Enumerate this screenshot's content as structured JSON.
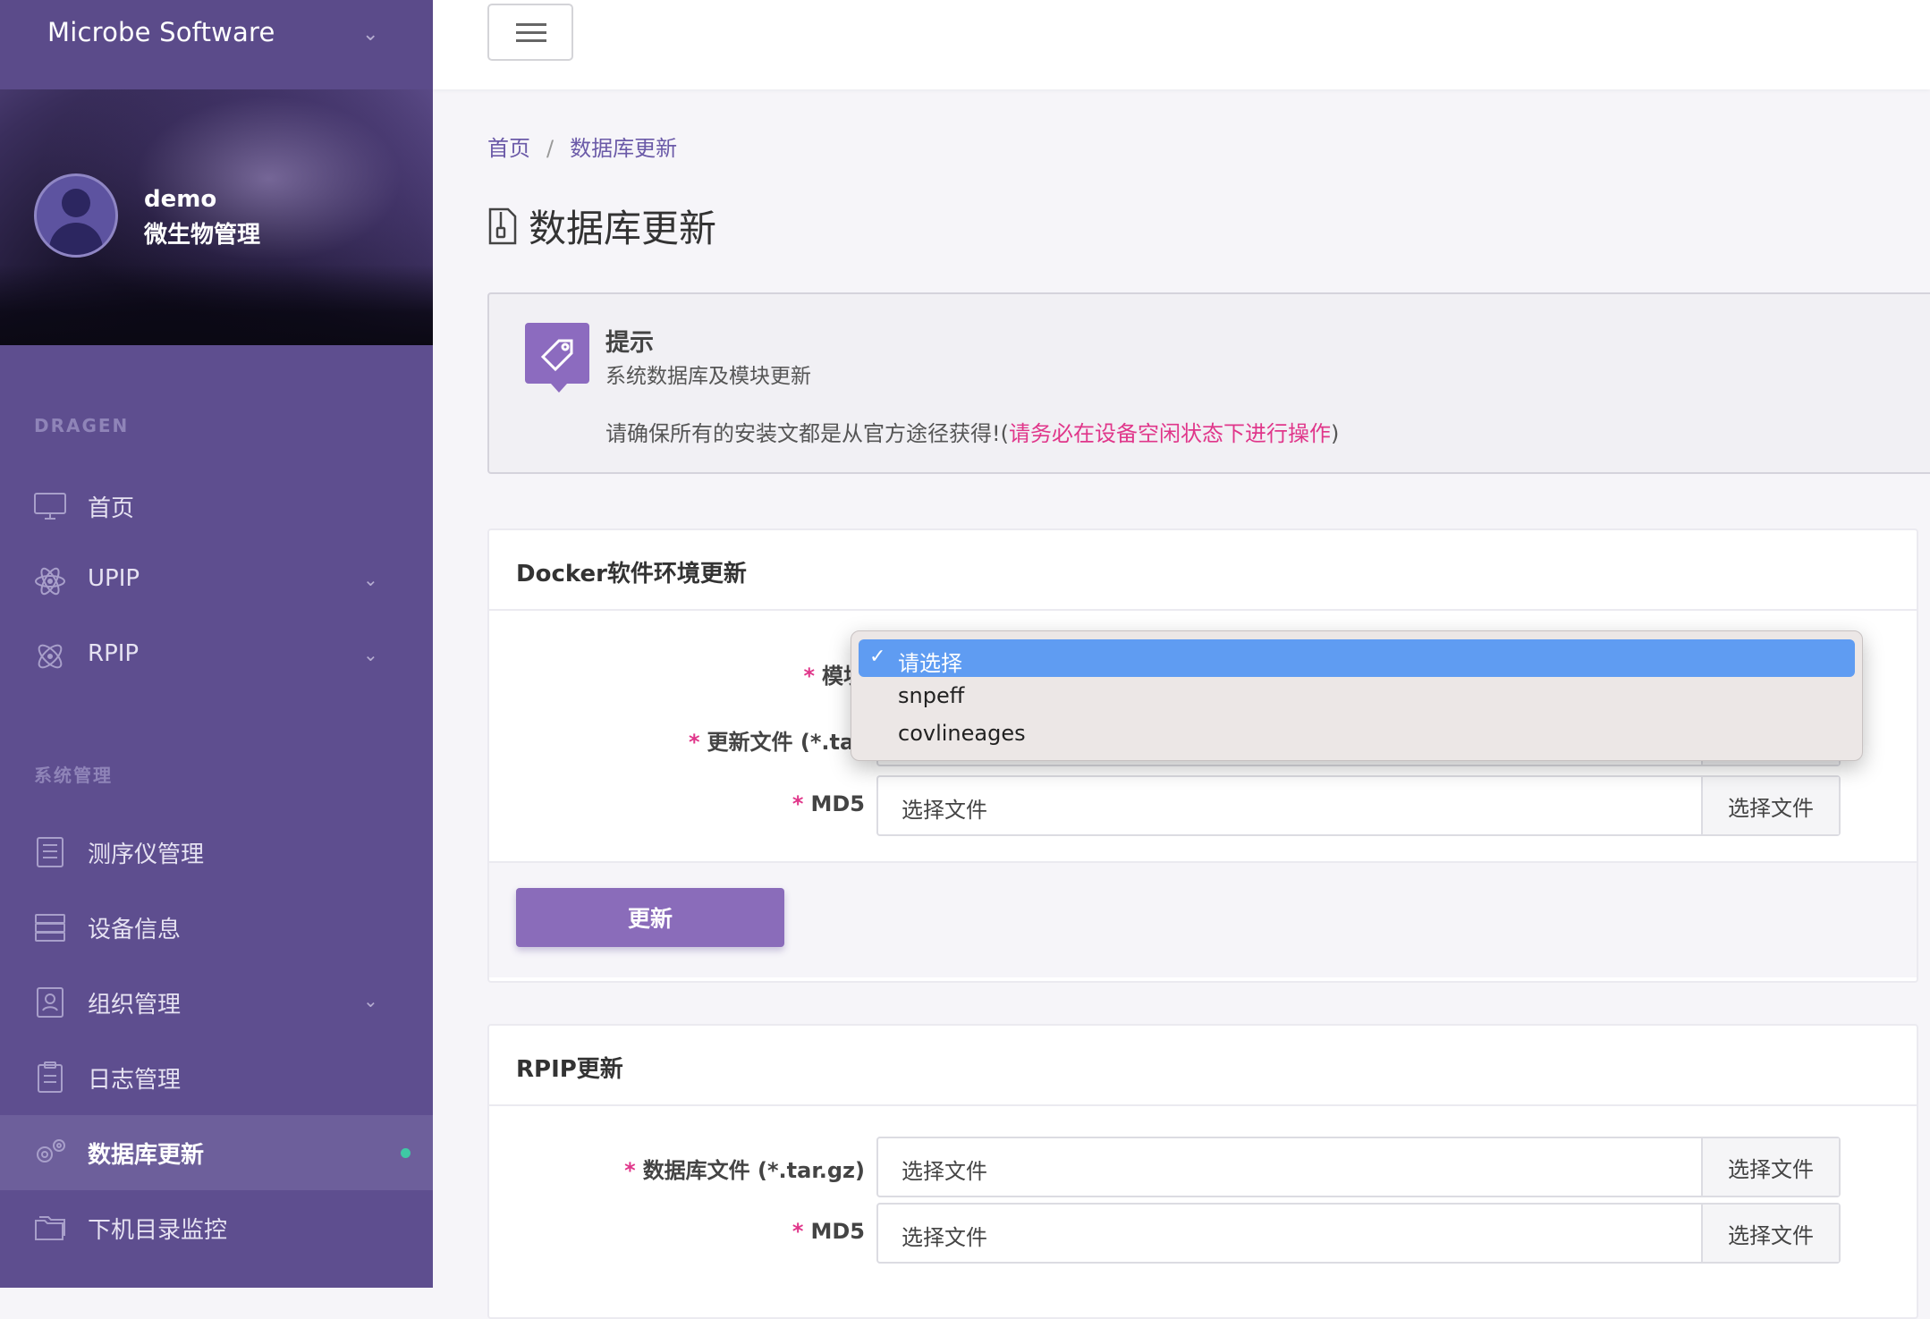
{
  "app": {
    "brand": "Microbe Software"
  },
  "profile": {
    "name": "demo",
    "role": "微生物管理"
  },
  "sidebar": {
    "sections": [
      {
        "title": "DRAGEN"
      },
      {
        "title": "系统管理"
      }
    ],
    "items": [
      {
        "label": "首页",
        "icon": "monitor-icon"
      },
      {
        "label": "UPIP",
        "icon": "atom-icon"
      },
      {
        "label": "RPIP",
        "icon": "molecule-icon"
      },
      {
        "label": "测序仪管理",
        "icon": "list-icon"
      },
      {
        "label": "设备信息",
        "icon": "server-icon"
      },
      {
        "label": "组织管理",
        "icon": "contact-icon"
      },
      {
        "label": "日志管理",
        "icon": "clipboard-icon"
      },
      {
        "label": "数据库更新",
        "icon": "gears-icon",
        "active": true
      },
      {
        "label": "下机目录监控",
        "icon": "folders-icon"
      }
    ]
  },
  "breadcrumb": {
    "home": "首页",
    "current": "数据库更新",
    "separator": "/"
  },
  "page": {
    "title": "数据库更新"
  },
  "alert": {
    "title": "提示",
    "subtitle": "系统数据库及模块更新",
    "message": "请确保所有的安装文都是从官方途径获得!(",
    "warning": "请务必在设备空闲状态下进行操作",
    "message_end": ")"
  },
  "docker_card": {
    "title": "Docker软件环境更新",
    "module_label": "模块",
    "file_label": "更新文件 (*.tar",
    "md5_label": "MD5",
    "md5_placeholder": "选择文件",
    "browse_label": "选择文件",
    "submit_label": "更新",
    "module_options": [
      "请选择",
      "snpeff",
      "covlineages"
    ],
    "module_selected": "请选择",
    "required_mark": "*"
  },
  "rpip_card": {
    "title": "RPIP更新",
    "db_label": "数据库文件 (*.tar.gz)",
    "db_placeholder": "选择文件",
    "md5_label": "MD5",
    "md5_placeholder": "选择文件",
    "browse_label": "选择文件",
    "required_mark": "*"
  },
  "colors": {
    "sidebar": "#5e4e8f",
    "accent": "#8a6cba",
    "required": "#e0368a",
    "dropdown_highlight": "#5f9cf2"
  }
}
